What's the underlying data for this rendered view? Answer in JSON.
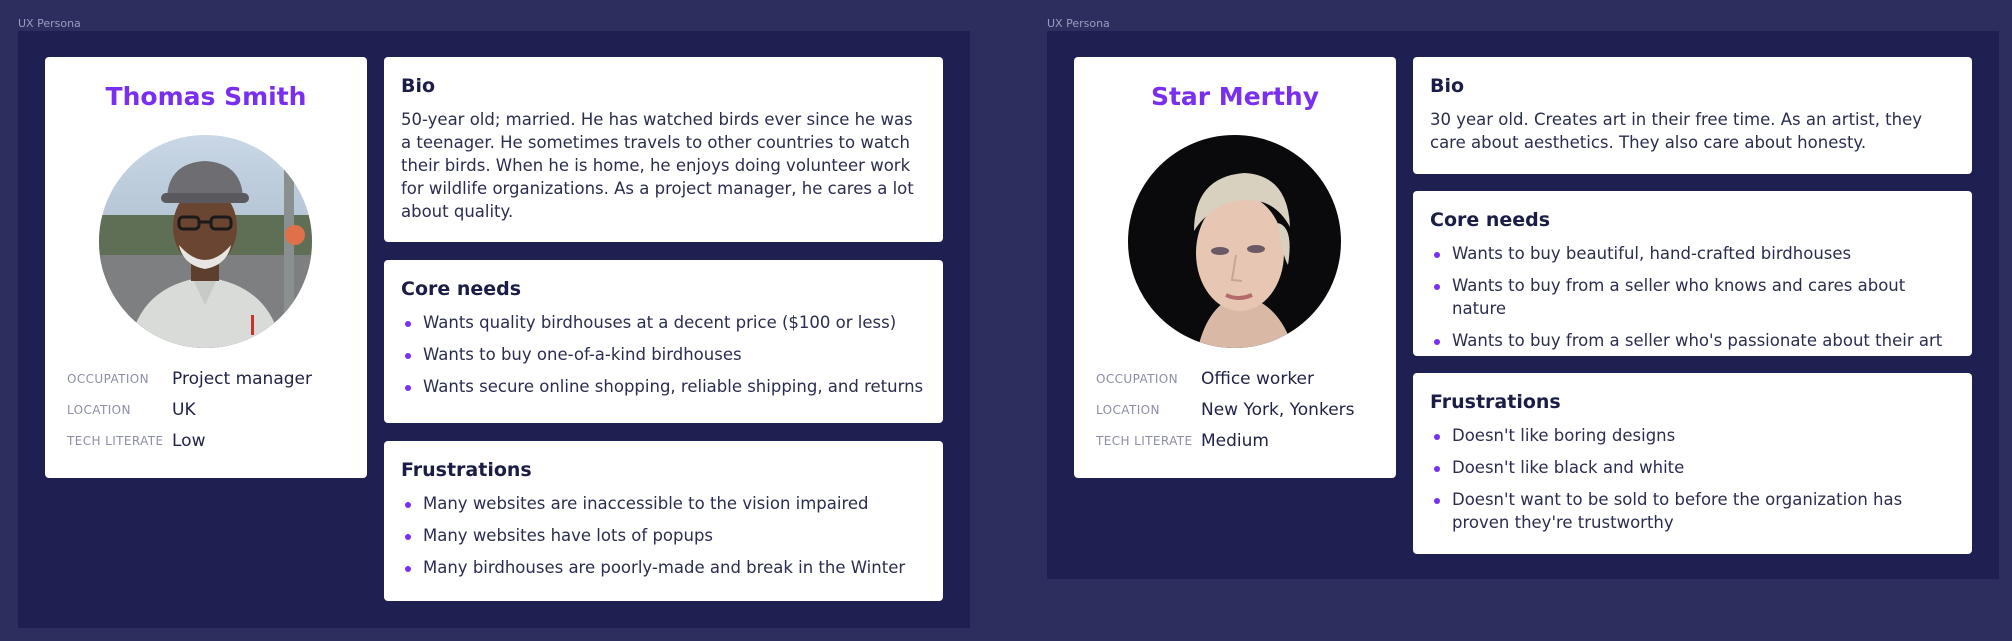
{
  "frames": [
    {
      "label": "UX Persona",
      "persona": {
        "name": "Thomas Smith",
        "attributes": [
          {
            "label": "OCCUPATION",
            "value": "Project manager"
          },
          {
            "label": "LOCATION",
            "value": "UK"
          },
          {
            "label": "TECH LITERATE",
            "value": "Low"
          }
        ],
        "bio_title": "Bio",
        "bio": "50-year old; married. He has watched birds ever since he was a teenager. He sometimes travels to other countries to watch their birds. When he is home, he enjoys doing volunteer work for wildlife organizations. As a project manager, he cares a lot about quality.",
        "needs_title": "Core needs",
        "needs": [
          "Wants quality birdhouses at a decent price ($100 or less)",
          "Wants to buy one-of-a-kind birdhouses",
          "Wants secure online shopping, reliable shipping, and returns"
        ],
        "frustrations_title": "Frustrations",
        "frustrations": [
          "Many websites are inaccessible to the vision impaired",
          "Many websites have lots of popups",
          "Many birdhouses are poorly-made and break in the Winter"
        ]
      }
    },
    {
      "label": "UX Persona",
      "persona": {
        "name": "Star Merthy",
        "attributes": [
          {
            "label": "OCCUPATION",
            "value": "Office worker"
          },
          {
            "label": "LOCATION",
            "value": "New York, Yonkers"
          },
          {
            "label": "TECH LITERATE",
            "value": "Medium"
          }
        ],
        "bio_title": "Bio",
        "bio": "30 year old. Creates art in their free time. As an artist, they care about aesthetics. They also care about honesty.",
        "needs_title": "Core needs",
        "needs": [
          "Wants to buy beautiful, hand-crafted birdhouses",
          "Wants to buy from a seller who knows and cares about nature",
          "Wants to buy from a seller who's passionate about their art"
        ],
        "frustrations_title": "Frustrations",
        "frustrations": [
          "Doesn't like boring designs",
          "Doesn't like black and white",
          "Doesn't want to be sold to before the organization has proven they're trustworthy"
        ]
      }
    }
  ],
  "colors": {
    "canvas": "#2c2f5e",
    "frame": "#1e2052",
    "card": "#ffffff",
    "accent": "#7a2ff0"
  }
}
